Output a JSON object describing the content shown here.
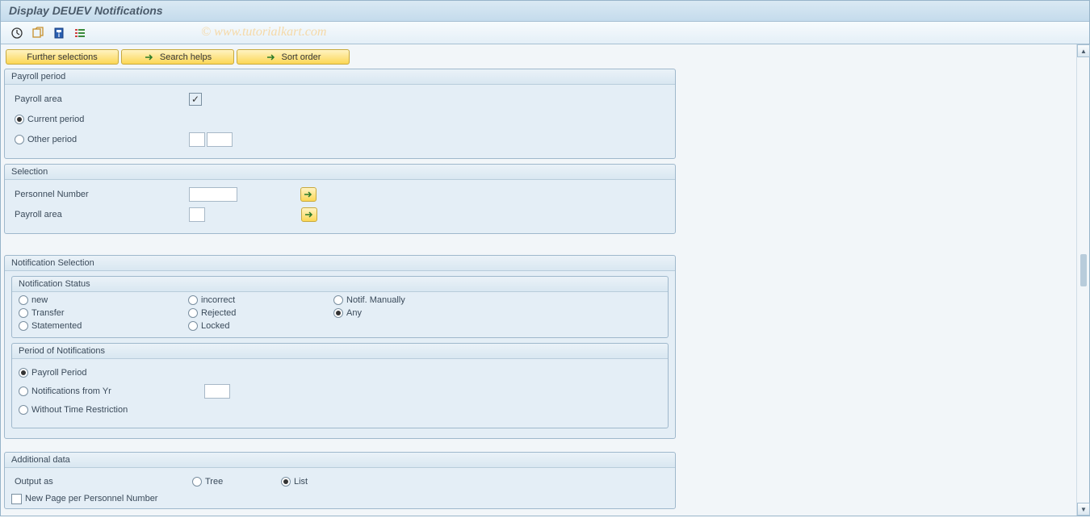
{
  "title": "Display DEUEV Notifications",
  "watermark": "© www.tutorialkart.com",
  "buttons": {
    "further_selections": "Further selections",
    "search_helps": "Search helps",
    "sort_order": "Sort order"
  },
  "groups": {
    "payroll_period": {
      "title": "Payroll period",
      "payroll_area_label": "Payroll area",
      "payroll_area_checked": "✓",
      "current_period": "Current period",
      "other_period": "Other period"
    },
    "selection": {
      "title": "Selection",
      "personnel_number": "Personnel Number",
      "payroll_area": "Payroll area"
    },
    "notification_selection": {
      "title": "Notification Selection",
      "status_title": "Notification Status",
      "status": {
        "new": "new",
        "incorrect": "incorrect",
        "notif_manually": "Notif. Manually",
        "transfer": "Transfer",
        "rejected": "Rejected",
        "any": "Any",
        "statemented": "Statemented",
        "locked": "Locked"
      },
      "period_title": "Period of Notifications",
      "period": {
        "payroll_period": "Payroll Period",
        "notifications_from_yr": "Notifications from Yr",
        "without_time_restriction": "Without Time Restriction"
      }
    },
    "additional_data": {
      "title": "Additional data",
      "output_as": "Output as",
      "tree": "Tree",
      "list": "List",
      "new_page": "New Page per Personnel Number"
    }
  }
}
